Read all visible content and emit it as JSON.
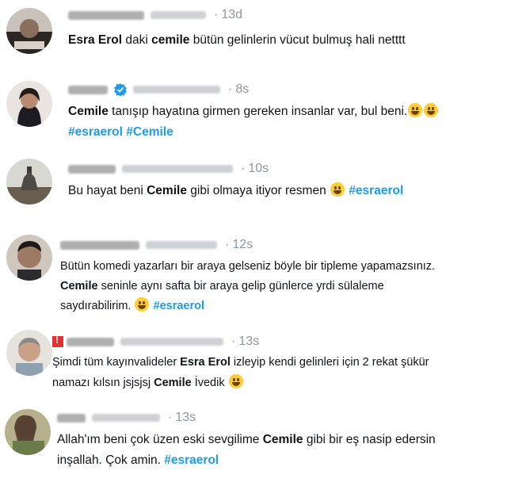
{
  "tweets": [
    {
      "time": "13d",
      "segments": [
        {
          "t": "Esra Erol",
          "s": "b"
        },
        {
          "t": " daki ",
          "s": ""
        },
        {
          "t": "cemile",
          "s": "b"
        },
        {
          "t": " bütün gelinlerin vücut bulmuş hali netttt",
          "s": ""
        }
      ]
    },
    {
      "time": "8s",
      "verified": true,
      "lines": [
        [
          {
            "t": "Cemile",
            "s": "b"
          },
          {
            "t": " tanışıp hayatına girmen gereken insanlar var, bul beni.",
            "s": ""
          },
          {
            "t": "grin-emoji",
            "s": "emoji"
          },
          {
            "t": "grin-emoji",
            "s": "emoji"
          }
        ],
        [
          {
            "t": "#esraerol",
            "s": "tag"
          },
          {
            "t": " ",
            "s": ""
          },
          {
            "t": "#Cemile",
            "s": "tag"
          }
        ]
      ]
    },
    {
      "time": "10s",
      "lines": [
        [
          {
            "t": "Bu hayat beni  ",
            "s": ""
          },
          {
            "t": "Cemile",
            "s": "b"
          },
          {
            "t": " gibi olmaya itiyor resmen ",
            "s": ""
          },
          {
            "t": "joy-emoji",
            "s": "emoji"
          },
          {
            "t": " ",
            "s": ""
          },
          {
            "t": "#esraerol",
            "s": "tag"
          }
        ]
      ]
    },
    {
      "time": "12s",
      "lines": [
        [
          {
            "t": "Bütün komedi yazarları bir araya gelseniz böyle bir tipleme yapamazsınız.",
            "s": ""
          }
        ],
        [
          {
            "t": "Cemile",
            "s": "b"
          },
          {
            "t": " seninle aynı safta bir araya gelip günlerce yrdi sülaleme",
            "s": ""
          }
        ],
        [
          {
            "t": "saydırabilirim. ",
            "s": ""
          },
          {
            "t": "grin-emoji",
            "s": "emoji"
          },
          {
            "t": " ",
            "s": ""
          },
          {
            "t": "#esraerol",
            "s": "tag"
          }
        ]
      ]
    },
    {
      "time": "13s",
      "warn": true,
      "lines": [
        [
          {
            "t": "Şimdi tüm kayınvalideler ",
            "s": ""
          },
          {
            "t": "Esra Erol",
            "s": "b"
          },
          {
            "t": " izleyip kendi gelinleri için 2 rekat şükür",
            "s": ""
          }
        ],
        [
          {
            "t": "namazı kılsın jsjsjsj ",
            "s": ""
          },
          {
            "t": "Cemile",
            "s": "b"
          },
          {
            "t": " İvedik ",
            "s": ""
          },
          {
            "t": "joy-emoji",
            "s": "emoji"
          }
        ]
      ]
    },
    {
      "time": "13s",
      "lines": [
        [
          {
            "t": "Allah'ım beni çok üzen eski sevgilime ",
            "s": ""
          },
          {
            "t": "Cemile",
            "s": "b"
          },
          {
            "t": " gibi bir eş nasip edersin",
            "s": ""
          }
        ],
        [
          {
            "t": "inşallah. Çok amin. ",
            "s": ""
          },
          {
            "t": "#esraerol",
            "s": "tag"
          }
        ]
      ]
    }
  ]
}
